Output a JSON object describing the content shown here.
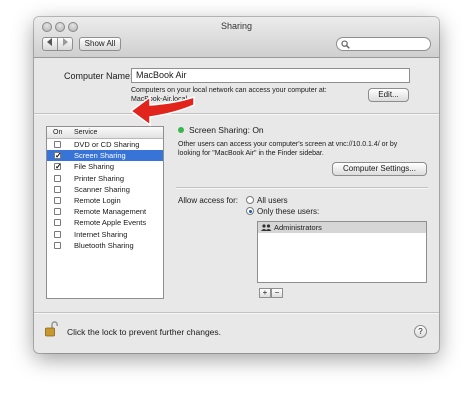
{
  "window": {
    "title": "Sharing",
    "show_all_label": "Show All",
    "back_icon": "chevron-left-icon",
    "forward_icon": "chevron-right-icon",
    "search_placeholder": ""
  },
  "computer_name": {
    "label": "Computer Name:",
    "value": "MacBook Air",
    "note_line1": "Computers on your local network can access your computer at:",
    "note_line2": "MacBook-Air.local",
    "edit_label": "Edit..."
  },
  "services": {
    "col_on": "On",
    "col_service": "Service",
    "items": [
      {
        "label": "DVD or CD Sharing",
        "on": false,
        "selected": false
      },
      {
        "label": "Screen Sharing",
        "on": true,
        "selected": true
      },
      {
        "label": "File Sharing",
        "on": true,
        "selected": false
      },
      {
        "label": "Printer Sharing",
        "on": false,
        "selected": false
      },
      {
        "label": "Scanner Sharing",
        "on": false,
        "selected": false
      },
      {
        "label": "Remote Login",
        "on": false,
        "selected": false
      },
      {
        "label": "Remote Management",
        "on": false,
        "selected": false
      },
      {
        "label": "Remote Apple Events",
        "on": false,
        "selected": false
      },
      {
        "label": "Internet Sharing",
        "on": false,
        "selected": false
      },
      {
        "label": "Bluetooth Sharing",
        "on": false,
        "selected": false
      }
    ]
  },
  "detail": {
    "status": "Screen Sharing: On",
    "status_color": "#3bb54a",
    "desc_line1": "Other users can access your computer's screen at vnc://10.0.1.4/ or by",
    "desc_line2": "looking for \"MacBook Air\" in the Finder sidebar.",
    "computer_settings_label": "Computer Settings...",
    "allow_label": "Allow access for:",
    "all_users_label": "All users",
    "only_these_label": "Only these users:",
    "access_mode": "only_these",
    "users": [
      "Administrators"
    ],
    "add_label": "+",
    "remove_label": "−"
  },
  "footer": {
    "lock_text": "Click the lock to prevent further changes.",
    "help_label": "?"
  },
  "colors": {
    "selection": "#3874d7",
    "annotation_arrow": "#e2251c"
  }
}
